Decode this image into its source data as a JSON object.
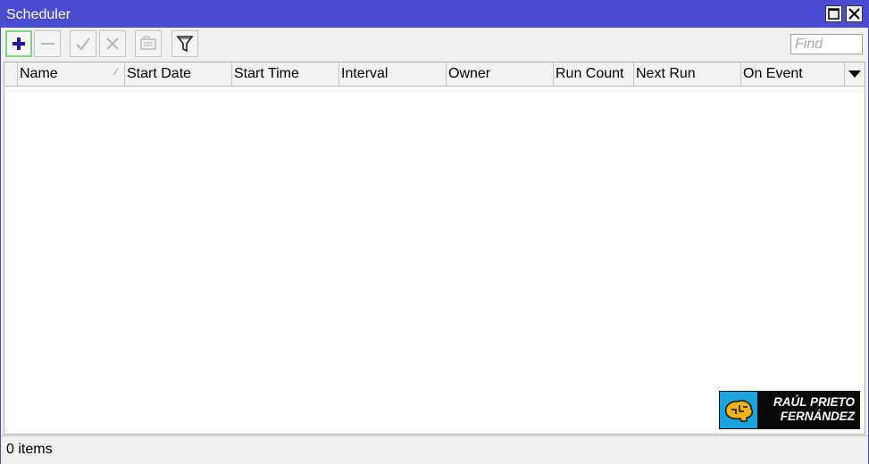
{
  "window": {
    "title": "Scheduler"
  },
  "toolbar": {
    "buttons": [
      {
        "name": "add",
        "icon": "plus-icon",
        "color": "#1a1aa8",
        "active": true
      },
      {
        "name": "remove",
        "icon": "minus-icon"
      },
      {
        "name": "enable",
        "icon": "check-icon"
      },
      {
        "name": "disable",
        "icon": "cross-icon"
      },
      {
        "name": "comment",
        "icon": "comment-icon"
      },
      {
        "name": "filter",
        "icon": "filter-icon"
      }
    ],
    "find_placeholder": "Find",
    "find_value": ""
  },
  "table": {
    "columns": [
      "Name",
      "Start Date",
      "Start Time",
      "Interval",
      "Owner",
      "Run Count",
      "Next Run",
      "On Event"
    ],
    "sort_column": "Name",
    "rows": []
  },
  "watermark": {
    "line1": "RAÚL PRIETO",
    "line2": "FERNÁNDEZ"
  },
  "status": {
    "items_text": "0 items"
  },
  "colors": {
    "titlebar": "#4b4bd2",
    "add_active_border": "#7fd77f",
    "logo_accent": "#1aa3dd",
    "logo_gold": "#f2b318"
  }
}
